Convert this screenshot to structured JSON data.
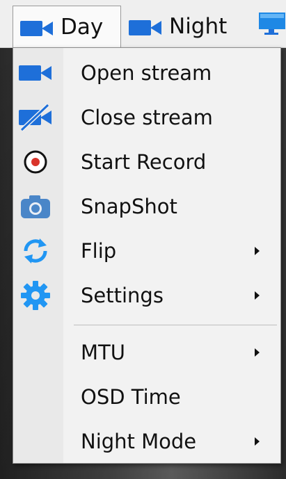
{
  "tabs": [
    {
      "label": "Day",
      "icon": "video-camera-icon",
      "active": true
    },
    {
      "label": "Night",
      "icon": "video-camera-icon",
      "active": false
    },
    {
      "label": "",
      "icon": "monitor-icon",
      "active": false
    }
  ],
  "menu": {
    "items": [
      {
        "label": "Open stream",
        "icon": "video-camera-icon",
        "submenu": false
      },
      {
        "label": "Close stream",
        "icon": "video-camera-off-icon",
        "submenu": false
      },
      {
        "label": "Start Record",
        "icon": "record-icon",
        "submenu": false
      },
      {
        "label": "SnapShot",
        "icon": "camera-icon",
        "submenu": false
      },
      {
        "label": "Flip",
        "icon": "rotate-arrows-icon",
        "submenu": true
      },
      {
        "label": "Settings",
        "icon": "gear-icon",
        "submenu": true
      },
      {
        "label": "MTU",
        "icon": "",
        "submenu": true
      },
      {
        "label": "OSD Time",
        "icon": "",
        "submenu": false
      },
      {
        "label": "Night Mode",
        "icon": "",
        "submenu": true
      }
    ]
  },
  "colors": {
    "accent": "#1e6fd9",
    "record_red": "#d9342b",
    "menu_bg": "#f2f2f2",
    "gutter_bg": "#e9e9e9"
  }
}
